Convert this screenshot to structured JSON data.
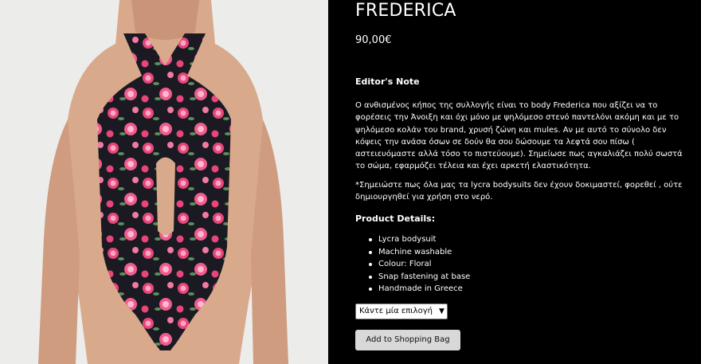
{
  "product": {
    "title": "FREDERICA",
    "price": "90,00€",
    "image_alt": "Floral halter bodysuit"
  },
  "editors_note": {
    "heading": "Editor's Note",
    "paragraph_1": "Ο ανθισμένος κήπος της συλλογής είναι το body Frederica που αξίζει να το φορέσεις την Άνοιξη και όχι μόνο με ψηλόμεσο στενό παντελόνι ακόμη και με το ψηλόμεσο κολάν του brand, χρυσή ζώνη και mules. Αν με αυτό το σύνολο δεν κόψεις την ανάσα όσων σε δούν θα σου δώσουμε τα λεφτά σου πίσω ( αστειευόμαστε αλλά τόσο το πιστεύουμε). Σημείωσε πως αγκαλιάζει πολύ σωστά το σώμα, εφαρμόζει τέλεια και έχει αρκετή ελαστικότητα.",
    "paragraph_2": "*Σημειώστε πως όλα μας τα lycra bodysuits δεν έχουν δοκιμαστεί, φορεθεί , ούτε δημιουργηθεί για χρήση στο νερό."
  },
  "product_details": {
    "heading": "Product Details:",
    "items": [
      "Lycra bodysuit",
      "Machine washable",
      "Colour: Floral",
      "Snap fastening at base",
      "Handmade in Greece"
    ]
  },
  "options": {
    "select_value": "Κάντε μία επιλογή"
  },
  "actions": {
    "add_to_bag": "Add to Shopping Bag"
  },
  "colors": {
    "background": "#000000",
    "button": "#d8d8d8",
    "garment_base": "#1b1a22",
    "rose_pink": "#e8457a"
  }
}
